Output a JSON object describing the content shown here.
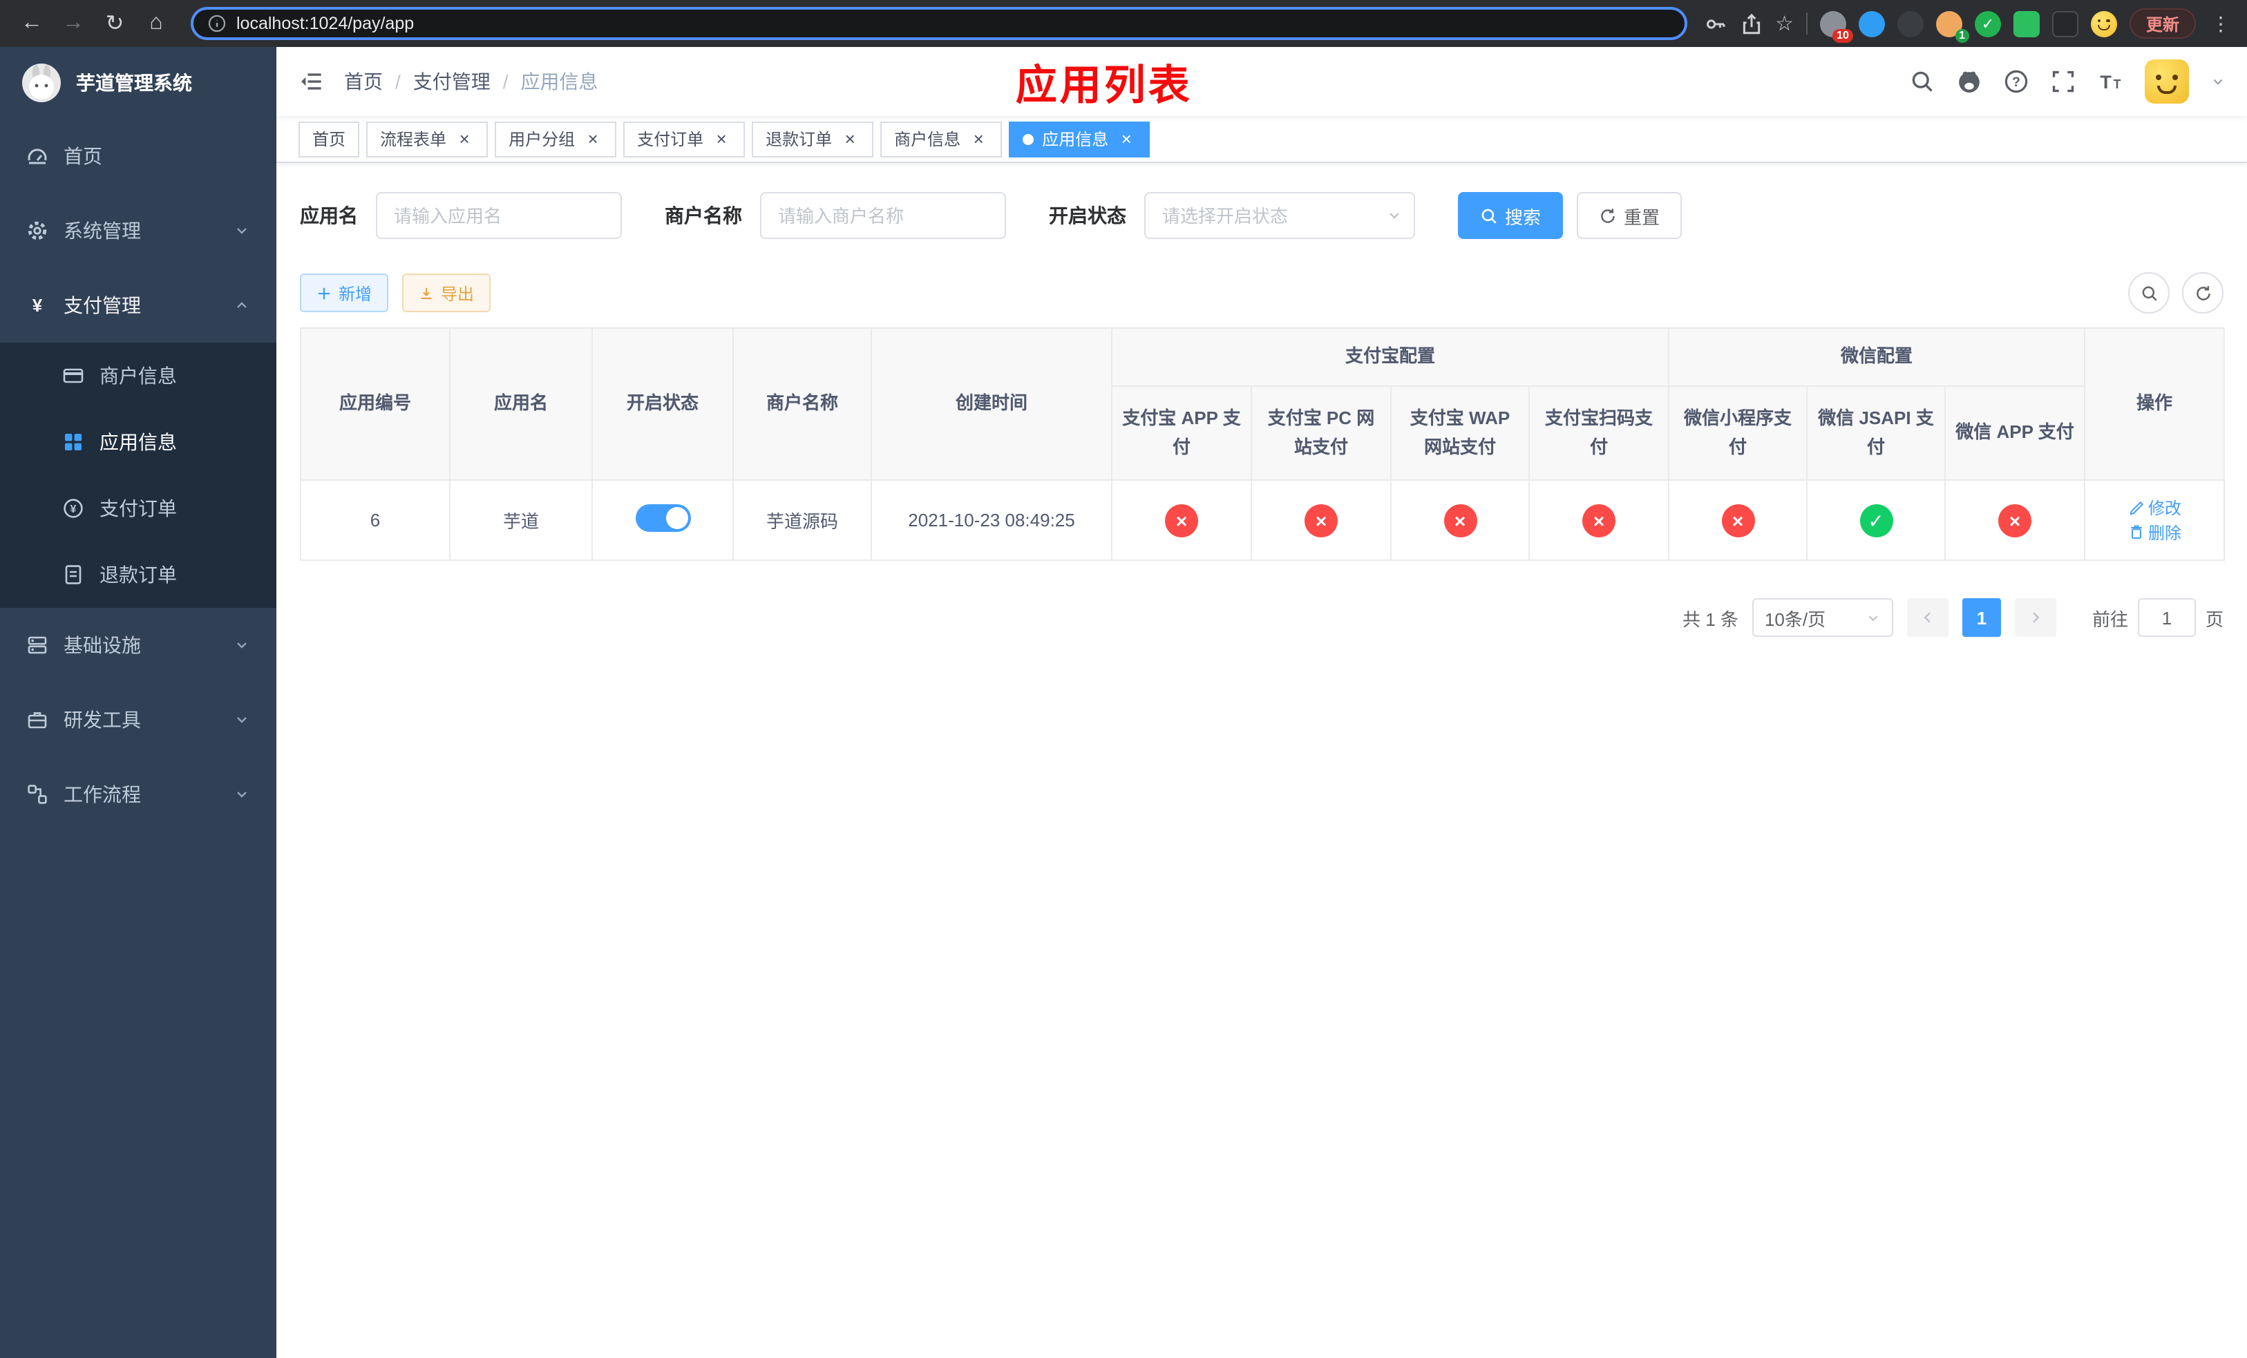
{
  "browser": {
    "url": "localhost:1024/pay/app",
    "update_label": "更新",
    "extensions_badge": "10",
    "profile_badge": "1"
  },
  "annotation": "应用列表",
  "sidebar": {
    "title": "芋道管理系统",
    "menu": [
      {
        "label": "首页"
      },
      {
        "label": "系统管理"
      },
      {
        "label": "支付管理"
      },
      {
        "label": "基础设施"
      },
      {
        "label": "研发工具"
      },
      {
        "label": "工作流程"
      }
    ],
    "submenu": [
      {
        "label": "商户信息"
      },
      {
        "label": "应用信息"
      },
      {
        "label": "支付订单"
      },
      {
        "label": "退款订单"
      }
    ]
  },
  "header": {
    "breadcrumb": [
      "首页",
      "支付管理",
      "应用信息"
    ]
  },
  "tabs": [
    {
      "label": "首页"
    },
    {
      "label": "流程表单"
    },
    {
      "label": "用户分组"
    },
    {
      "label": "支付订单"
    },
    {
      "label": "退款订单"
    },
    {
      "label": "商户信息"
    },
    {
      "label": "应用信息"
    }
  ],
  "filters": {
    "app_name_label": "应用名",
    "app_name_placeholder": "请输入应用名",
    "merchant_label": "商户名称",
    "merchant_placeholder": "请输入商户名称",
    "status_label": "开启状态",
    "status_placeholder": "请选择开启状态",
    "search_label": "搜索",
    "reset_label": "重置"
  },
  "toolbar": {
    "add_label": "新增",
    "export_label": "导出"
  },
  "table": {
    "headers": {
      "app_id": "应用编号",
      "app_name": "应用名",
      "status": "开启状态",
      "merchant": "商户名称",
      "create_time": "创建时间",
      "alipay_group": "支付宝配置",
      "wechat_group": "微信配置",
      "alipay_app": "支付宝 APP 支付",
      "alipay_pc": "支付宝 PC 网站支付",
      "alipay_wap": "支付宝 WAP 网站支付",
      "alipay_qr": "支付宝扫码支付",
      "wx_lite": "微信小程序支付",
      "wx_jsapi": "微信 JSAPI 支付",
      "wx_app": "微信 APP 支付",
      "actions": "操作"
    },
    "rows": [
      {
        "app_id": "6",
        "app_name": "芋道",
        "status_on": true,
        "merchant": "芋道源码",
        "create_time": "2021-10-23 08:49:25",
        "alipay_app": false,
        "alipay_pc": false,
        "alipay_wap": false,
        "alipay_qr": false,
        "wx_lite": false,
        "wx_jsapi": true,
        "wx_app": false,
        "edit_label": "修改",
        "delete_label": "删除"
      }
    ]
  },
  "pagination": {
    "total_label": "共 1 条",
    "page_size_label": "10条/页",
    "current_page": "1",
    "goto_label": "前往",
    "goto_value": "1",
    "page_unit_label": "页"
  },
  "ui": {
    "close_glyph": "×",
    "cross_glyph": "×",
    "check_glyph": "✓",
    "breadcrumb_sep": "/"
  }
}
